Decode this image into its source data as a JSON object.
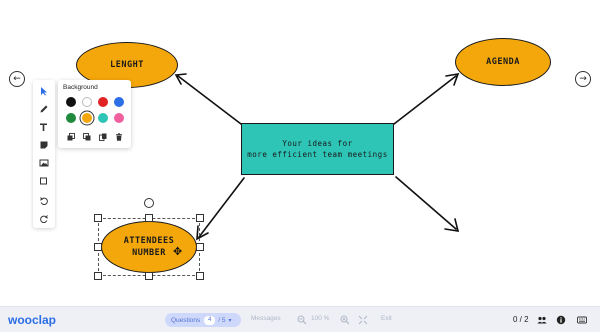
{
  "board": {
    "nodes": {
      "lenght": "LENGHT",
      "agenda": "AGENDA",
      "attendees_line1": "ATTENDEES",
      "attendees_line2": "NUMBER",
      "center_line1": "Your ideas for",
      "center_line2": "more efficient team meetings"
    },
    "colors": {
      "oval": "#f4a70b",
      "center": "#2ec4b6"
    }
  },
  "toolbar": {
    "tools": [
      "select-tool",
      "pen-tool",
      "text-tool",
      "sticky-note-tool",
      "image-tool",
      "shape-tool",
      "undo-tool",
      "redo-tool"
    ]
  },
  "palette": {
    "title": "Background",
    "swatches": [
      "#111111",
      "#ffffff",
      "#e02424",
      "#2b6ee6",
      "#1f8a3b",
      "#f4a70b",
      "#2ec4b6",
      "#f0609e"
    ],
    "selected": "#f4a70b"
  },
  "bottom_bar": {
    "brand": "wooclap",
    "questions_label": "Questions",
    "questions_count": "4",
    "questions_total": "/ 5",
    "messages_label": "Messages",
    "zoom": "100 %",
    "exit_label": "Exit",
    "participants": "0 / 2"
  }
}
